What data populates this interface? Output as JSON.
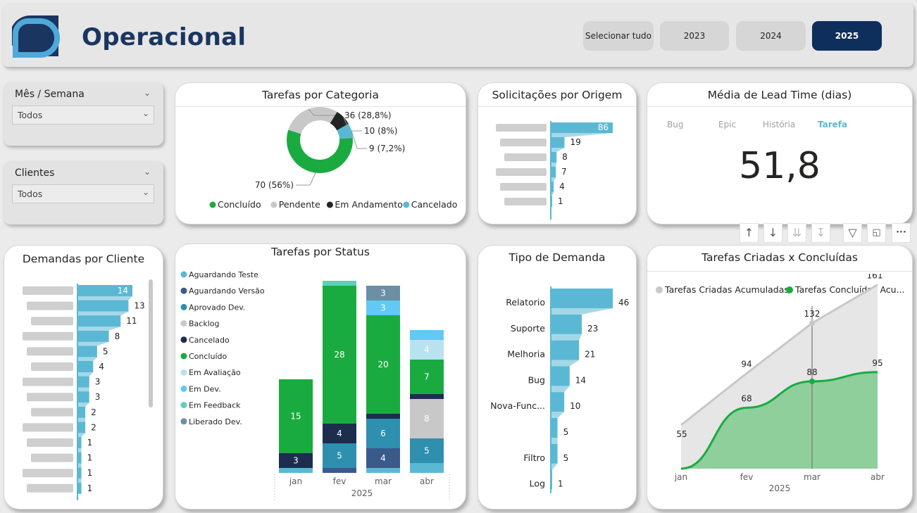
{
  "header": {
    "title": "Operacional",
    "buttons": [
      {
        "label": "Selecionar tudo"
      },
      {
        "label": "2023"
      },
      {
        "label": "2024"
      },
      {
        "label": "2025"
      }
    ],
    "selected": "2025",
    "accent": "#0e2e5c"
  },
  "slicers": [
    {
      "label": "Mês / Semana",
      "value": "Todos"
    },
    {
      "label": "Clientes",
      "value": "Todos"
    }
  ],
  "cards": {
    "categoria": {
      "title": "Tarefas por Categoria"
    },
    "origem": {
      "title": "Solicitações por Origem"
    },
    "leadtime": {
      "title": "Média de Lead Time (dias)",
      "tabs": [
        "Bug",
        "Epic",
        "História",
        "Tarefa"
      ],
      "selected_tab": "Tarefa",
      "value": "51,8"
    },
    "cliente": {
      "title": "Demandas por Cliente"
    },
    "status": {
      "title": "Tarefas por Status"
    },
    "tipo": {
      "title": "Tipo de Demanda"
    },
    "criadas": {
      "title": "Tarefas Criadas x Concluídas"
    }
  },
  "toolbar": [
    "arrow-up-icon",
    "arrow-down-icon",
    "double-arrow-down-icon",
    "expand-hierarchy-icon",
    "filter-icon",
    "focus-mode-icon",
    "more-options-icon"
  ],
  "chart_data": [
    {
      "id": "categoria",
      "type": "pie",
      "title": "Tarefas por Categoria",
      "donut": true,
      "slices": [
        {
          "name": "Concluído",
          "value": 70,
          "label": "70 (56%)",
          "color": "#1aab40"
        },
        {
          "name": "Pendente",
          "value": 36,
          "label": "36 (28,8%)",
          "color": "#c8c8c8"
        },
        {
          "name": "Em Andamento",
          "value": 10,
          "label": "10 (8%)",
          "color": "#252423"
        },
        {
          "name": "Cancelado",
          "value": 9,
          "label": "9 (7,2%)",
          "color": "#5bb8d4"
        }
      ],
      "legend": "bottom"
    },
    {
      "id": "origem",
      "type": "bar",
      "orientation": "horizontal",
      "title": "Solicitações por Origem",
      "values": [
        86,
        19,
        8,
        7,
        4,
        1
      ],
      "categories_obscured": true,
      "color": "#5bb8d4"
    },
    {
      "id": "cliente",
      "type": "bar",
      "orientation": "horizontal",
      "title": "Demandas por Cliente",
      "values": [
        14,
        13,
        11,
        8,
        5,
        4,
        3,
        3,
        2,
        2,
        1,
        1,
        1,
        1
      ],
      "categories_obscured": true,
      "color": "#5bb8d4"
    },
    {
      "id": "status",
      "type": "bar",
      "stacked": true,
      "title": "Tarefas por Status",
      "categories": [
        "jan",
        "fev",
        "mar",
        "abr"
      ],
      "xgroup": "2025",
      "legend_items": [
        {
          "name": "Aguardando Teste",
          "color": "#5bb8d4"
        },
        {
          "name": "Aguardando Versão",
          "color": "#3a5a8a"
        },
        {
          "name": "Aprovado Dev.",
          "color": "#2e8fae"
        },
        {
          "name": "Backlog",
          "color": "#c8c8c8"
        },
        {
          "name": "Cancelado",
          "color": "#1d2d4e"
        },
        {
          "name": "Concluído",
          "color": "#1aab40"
        },
        {
          "name": "Em Avaliação",
          "color": "#b8e2f0"
        },
        {
          "name": "Em Dev.",
          "color": "#62c8f5"
        },
        {
          "name": "Em Feedback",
          "color": "#5fd0b5"
        },
        {
          "name": "Liberado Dev.",
          "color": "#6b8fa3"
        }
      ],
      "stacks": [
        [
          {
            "s": "Aguardando Teste",
            "v": 1
          },
          {
            "s": "Cancelado",
            "v": 3,
            "label": "3"
          },
          {
            "s": "Concluído",
            "v": 15,
            "label": "15"
          }
        ],
        [
          {
            "s": "Aguardando Versão",
            "v": 1
          },
          {
            "s": "Aprovado Dev.",
            "v": 5,
            "label": "5"
          },
          {
            "s": "Cancelado",
            "v": 4,
            "label": "4"
          },
          {
            "s": "Concluído",
            "v": 28,
            "label": "28"
          },
          {
            "s": "Em Feedback",
            "v": 1
          }
        ],
        [
          {
            "s": "Aguardando Teste",
            "v": 1
          },
          {
            "s": "Aguardando Versão",
            "v": 4,
            "label": "4"
          },
          {
            "s": "Aprovado Dev.",
            "v": 6,
            "label": "6"
          },
          {
            "s": "Cancelado",
            "v": 1
          },
          {
            "s": "Concluído",
            "v": 20,
            "label": "20"
          },
          {
            "s": "Em Dev.",
            "v": 3,
            "label": "3"
          },
          {
            "s": "Liberado Dev.",
            "v": 3,
            "label": "3"
          }
        ],
        [
          {
            "s": "Aguardando Teste",
            "v": 2
          },
          {
            "s": "Aprovado Dev.",
            "v": 5,
            "label": "5"
          },
          {
            "s": "Backlog",
            "v": 8,
            "label": "8"
          },
          {
            "s": "Cancelado",
            "v": 1
          },
          {
            "s": "Concluído",
            "v": 7,
            "label": "7"
          },
          {
            "s": "Em Avaliação",
            "v": 4,
            "label": "4"
          },
          {
            "s": "Em Dev.",
            "v": 2
          }
        ]
      ]
    },
    {
      "id": "tipo",
      "type": "bar",
      "orientation": "horizontal",
      "title": "Tipo de Demanda",
      "categories": [
        "Relatorio",
        "Suporte",
        "Melhoria",
        "Bug",
        "Nova-Func...",
        "",
        "Filtro",
        "Log"
      ],
      "values": [
        46,
        23,
        21,
        14,
        10,
        5,
        5,
        1
      ],
      "color": "#5bb8d4"
    },
    {
      "id": "criadas",
      "type": "area",
      "title": "Tarefas Criadas x Concluídas",
      "categories": [
        "jan",
        "fev",
        "mar",
        "abr"
      ],
      "xgroup": "2025",
      "series": [
        {
          "name": "Tarefas Criadas Acumuladas",
          "values": [
            55,
            94,
            132,
            161
          ],
          "color": "#c8c8c8"
        },
        {
          "name": "Tarefas Concluídas Acu...",
          "values": [
            22,
            68,
            88,
            95
          ],
          "color": "#1aab40"
        }
      ],
      "first_point_label": "55",
      "highlight": "mar"
    }
  ]
}
